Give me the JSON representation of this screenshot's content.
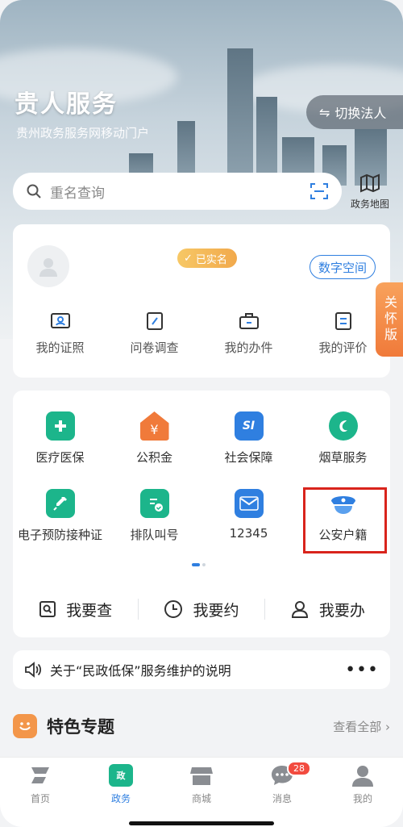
{
  "header": {
    "title": "贵人服务",
    "subtitle": "贵州政务服务网移动门户",
    "switch_label": "切换法人",
    "switch_icon": "swap-icon"
  },
  "search": {
    "placeholder": "重名查询",
    "map_label": "政务地图"
  },
  "profile": {
    "verified_label": "已实名",
    "digital_space_label": "数字空间",
    "items": [
      {
        "label": "我的证照",
        "icon": "id-card-icon"
      },
      {
        "label": "问卷调查",
        "icon": "survey-icon"
      },
      {
        "label": "我的办件",
        "icon": "briefcase-icon"
      },
      {
        "label": "我的评价",
        "icon": "review-icon"
      }
    ]
  },
  "care_mode_label": "关怀版",
  "services": {
    "row1": [
      {
        "label": "医疗医保",
        "icon": "medical-icon",
        "color": "#1cb58b"
      },
      {
        "label": "公积金",
        "icon": "house-fund-icon",
        "color": "#f07a3a"
      },
      {
        "label": "社会保障",
        "icon": "social-security-icon",
        "color": "#2f7fe0"
      },
      {
        "label": "烟草服务",
        "icon": "tobacco-icon",
        "color": "#1cb58b"
      }
    ],
    "row2": [
      {
        "label": "电子预防接种证",
        "icon": "vaccine-icon",
        "color": "#1cb58b"
      },
      {
        "label": "排队叫号",
        "icon": "queue-icon",
        "color": "#1cb58b"
      },
      {
        "label": "12345",
        "icon": "mail-icon",
        "color": "#2f7fe0"
      },
      {
        "label": "公安户籍",
        "icon": "police-icon",
        "color": "#2f7fe0"
      }
    ],
    "quick": [
      {
        "label": "我要查",
        "icon": "search-doc-icon"
      },
      {
        "label": "我要约",
        "icon": "clock-icon"
      },
      {
        "label": "我要办",
        "icon": "person-icon"
      }
    ]
  },
  "notice": {
    "text": "关于“民政低保”服务维护的说明"
  },
  "topics": {
    "title": "特色专题",
    "view_all": "查看全部"
  },
  "tabbar": {
    "items": [
      {
        "label": "首页",
        "icon": "home-icon"
      },
      {
        "label": "政务",
        "icon": "gov-icon"
      },
      {
        "label": "商城",
        "icon": "shop-icon"
      },
      {
        "label": "消息",
        "icon": "message-icon"
      },
      {
        "label": "我的",
        "icon": "profile-icon"
      }
    ],
    "active": "政务",
    "message_badge": "28"
  },
  "colors": {
    "accent": "#2f7fe0",
    "highlight": "#d9241c",
    "badge": "#f24b3f"
  }
}
